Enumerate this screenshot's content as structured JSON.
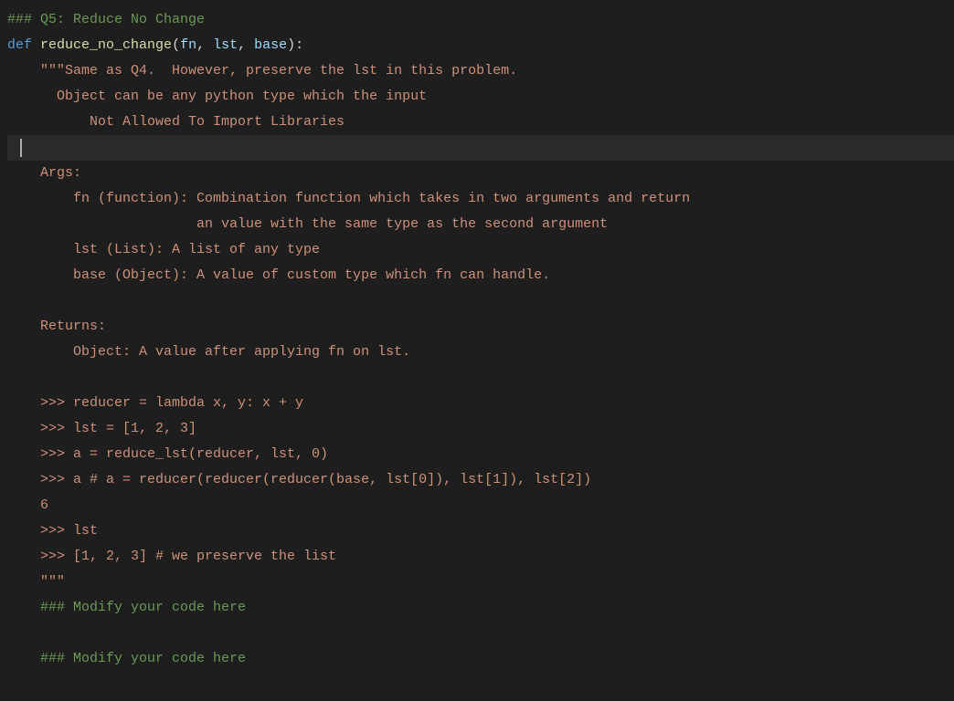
{
  "code": {
    "line1_comment": "### Q5: Reduce No Change",
    "line2_def": "def",
    "line2_sp1": " ",
    "line2_funcname": "reduce_no_change",
    "line2_paren_open": "(",
    "line2_p1": "fn",
    "line2_comma1": ", ",
    "line2_p2": "lst",
    "line2_comma2": ", ",
    "line2_p3": "base",
    "line2_paren_close": "):",
    "line3_doc": "    \"\"\"Same as Q4.  However, preserve the lst in this problem.",
    "line4_doc": "      Object can be any python type which the input",
    "line5_doc": "          Not Allowed To Import Libraries",
    "line7_doc": "    Args:",
    "line8_doc": "        fn (function): Combination function which takes in two arguments and return",
    "line9_doc": "                       an value with the same type as the second argument",
    "line10_doc": "        lst (List): A list of any type",
    "line11_doc": "        base (Object): A value of custom type which fn can handle.",
    "line13_doc": "    Returns:",
    "line14_doc": "        Object: A value after applying fn on lst.",
    "line16_doc": "    >>> reducer = lambda x, y: x + y",
    "line17_doc": "    >>> lst = [1, 2, 3]",
    "line18_doc": "    >>> a = reduce_lst(reducer, lst, 0)",
    "line19_doc": "    >>> a # a = reducer(reducer(reducer(base, lst[0]), lst[1]), lst[2])",
    "line20_doc": "    6",
    "line21_doc": "    >>> lst",
    "line22_doc": "    >>> [1, 2, 3] # we preserve the list",
    "line23_doc": "    \"\"\"",
    "line24_comment": "    ### Modify your code here",
    "line26_comment": "    ### Modify your code here"
  }
}
